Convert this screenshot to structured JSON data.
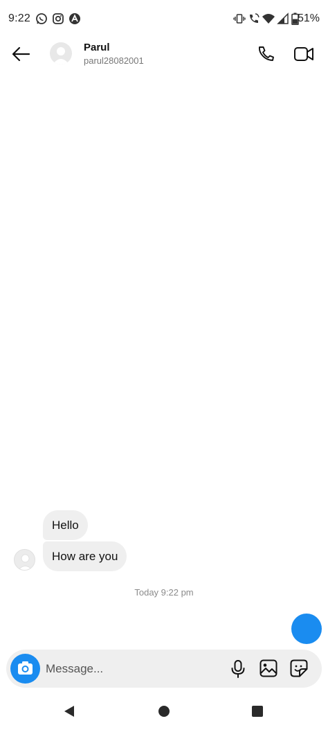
{
  "status_bar": {
    "time": "9:22",
    "battery": "51%",
    "icons": [
      "whatsapp-icon",
      "instagram-icon",
      "vpn-icon",
      "vibrate-icon",
      "wifi-call-icon",
      "wifi-icon",
      "signal-icon",
      "battery-icon"
    ]
  },
  "header": {
    "name": "Parul",
    "handle": "parul28082001"
  },
  "messages": [
    {
      "text": "Hello"
    },
    {
      "text": "How are you"
    }
  ],
  "timestamp": "Today 9:22 pm",
  "composer": {
    "placeholder": "Message..."
  },
  "colors": {
    "accent": "#1a8cf0",
    "bubble": "#efefef",
    "muted_text": "#8a8a8a"
  }
}
